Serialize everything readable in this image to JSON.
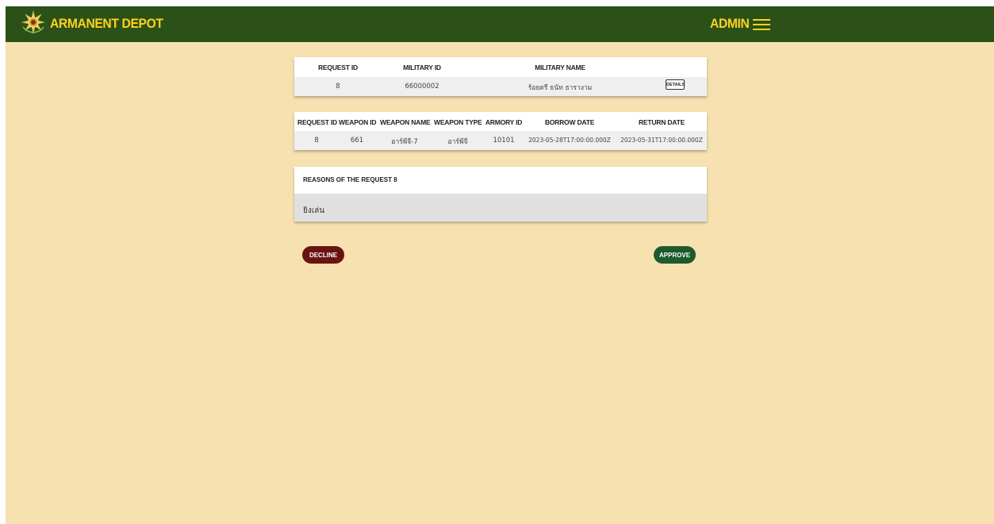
{
  "header": {
    "brand": "ARMANENT DEPOT",
    "logo_icon": "emblem-icon",
    "user_label": "ADMIN",
    "menu_icon": "hamburger-icon",
    "bar_color": "#2b5118",
    "accent_color": "#ffd21f"
  },
  "request_summary": {
    "columns": [
      "REQUEST ID",
      "MILITARY ID",
      "MILITARY NAME"
    ],
    "row": {
      "request_id": "8",
      "military_id": "66000002",
      "military_name": "ร้อยตรี ธนัท ธารางาม"
    },
    "details_label": "DETAILS"
  },
  "weapon_table": {
    "columns": [
      "REQUEST ID",
      "WEAPON ID",
      "WEAPON NAME",
      "WEAPON TYPE",
      "ARMORY ID",
      "BORROW DATE",
      "RETURN DATE"
    ],
    "rows": [
      [
        "8",
        "661",
        "อาร์พีจี-7",
        "อาร์พีจี",
        "10101",
        "2023-05-28T17:00:00.000Z",
        "2023-05-31T17:00:00.000Z"
      ]
    ]
  },
  "reasons": {
    "title": "REASONS OF THE REQUEST 8",
    "text": "ยิงเล่น"
  },
  "actions": {
    "decline_label": "DECLINE",
    "approve_label": "APPROVE",
    "decline_color": "#6b1313",
    "approve_color": "#1f5a2e"
  },
  "page_bg": "#f7e1b0"
}
